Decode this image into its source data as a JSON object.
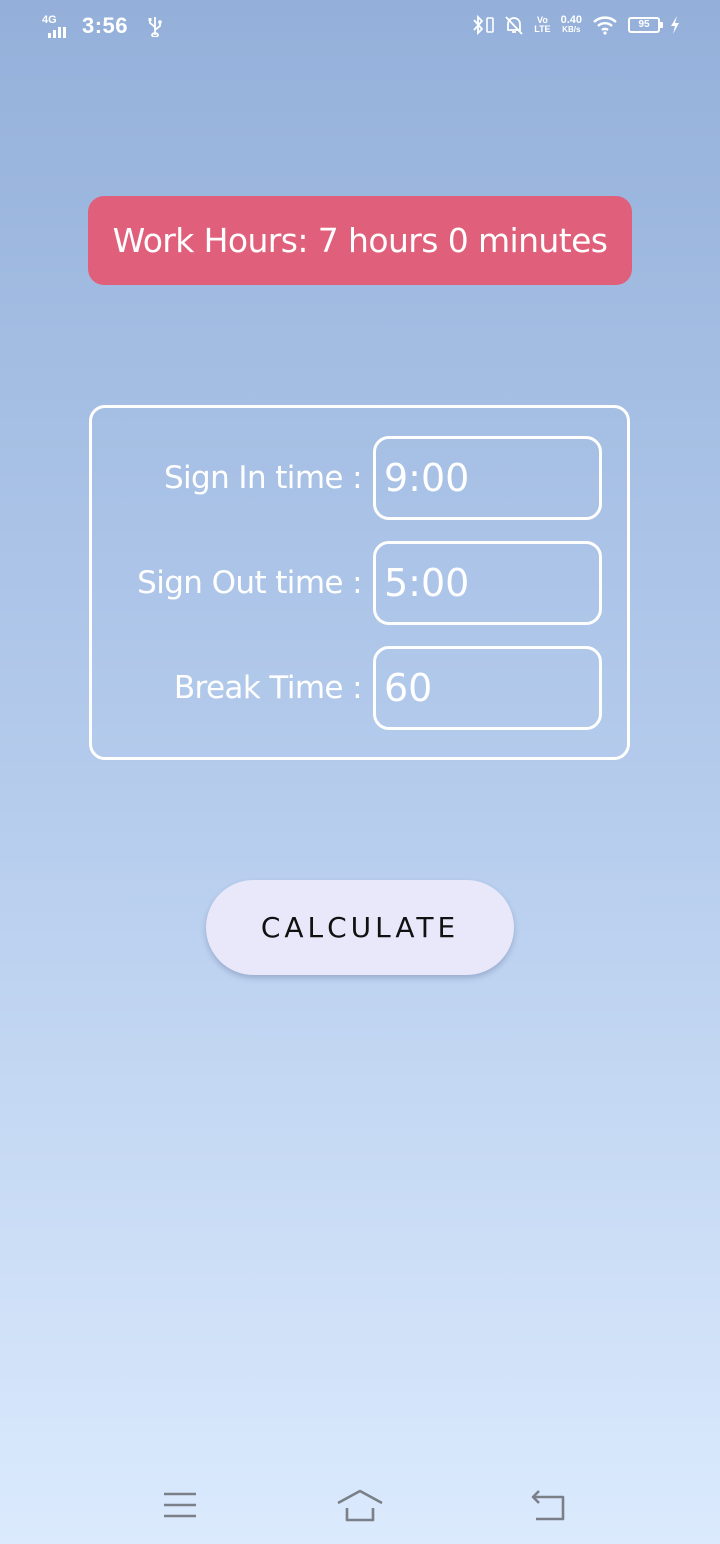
{
  "status_bar": {
    "network": "4G",
    "time": "3:56",
    "volte_top": "Vo",
    "volte_bottom": "LTE",
    "speed_value": "0.40",
    "speed_unit": "KB/s",
    "battery": "95",
    "icons": [
      "signal-icon",
      "usb-icon",
      "bluetooth-icon",
      "vibrate-icon",
      "mute-bell-icon",
      "wifi-icon",
      "battery-icon",
      "charging-icon"
    ]
  },
  "result": {
    "text": "Work Hours: 7 hours 0 minutes",
    "color": "#e0607c"
  },
  "form": {
    "sign_in_label": "Sign In time :",
    "sign_in_value": "9:00",
    "sign_out_label": "Sign Out time :",
    "sign_out_value": "5:00",
    "break_label": "Break Time :",
    "break_value": "60"
  },
  "calculate_button": {
    "label": "CALCULATE",
    "color": "#e9e8fb"
  },
  "nav_bar": {
    "icons": [
      "menu-icon",
      "home-icon",
      "back-icon"
    ]
  },
  "theme": {
    "background_top": "#94b0da",
    "background_bottom": "#dbeafd",
    "text": "#ffffff"
  }
}
